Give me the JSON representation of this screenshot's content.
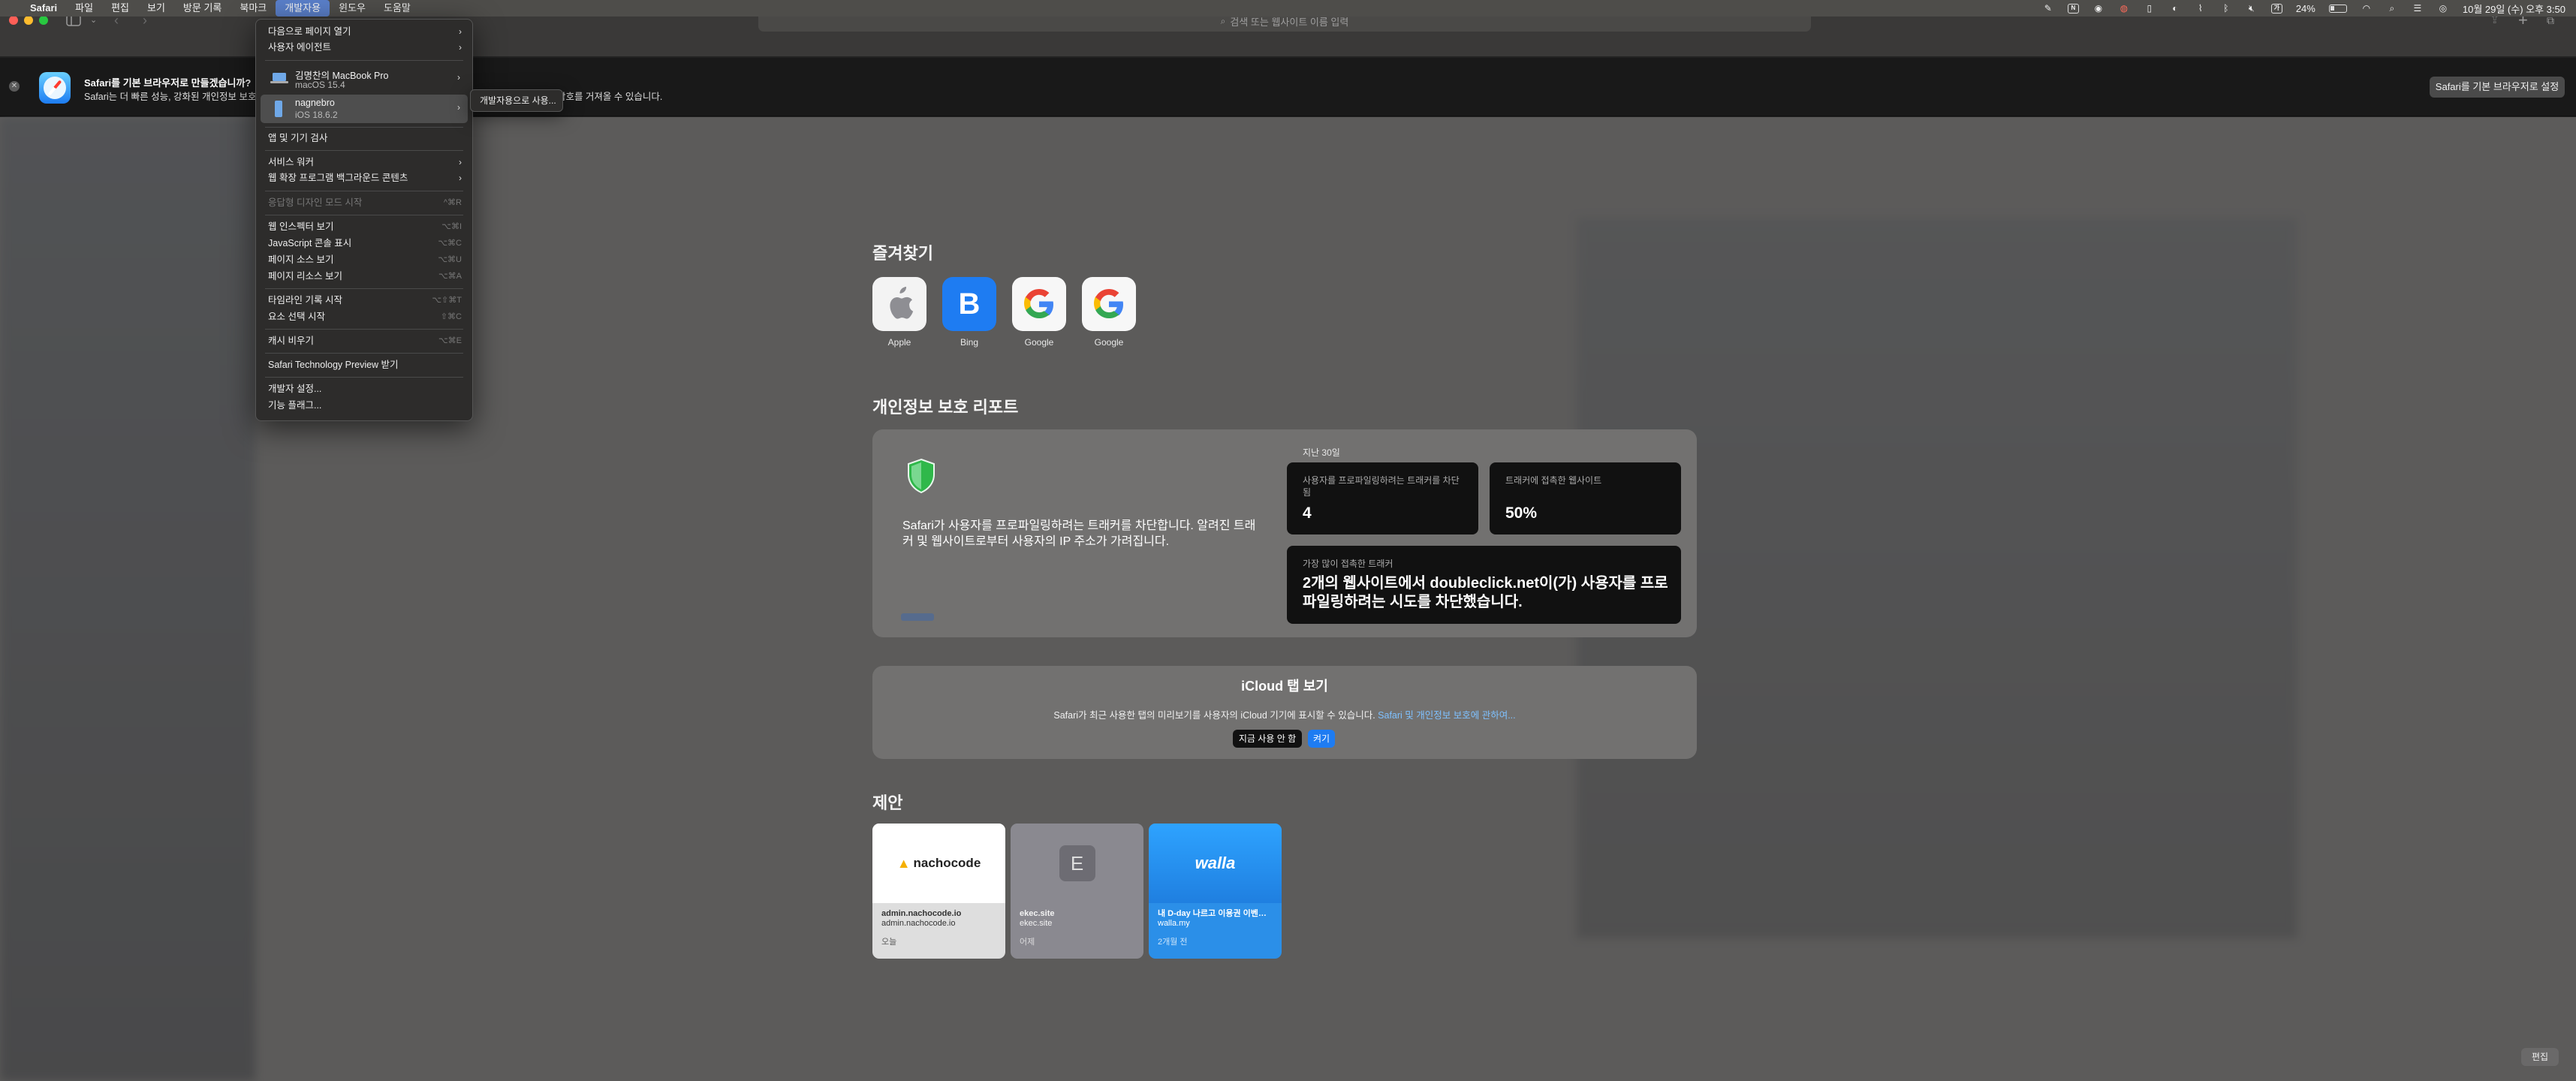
{
  "menubar": {
    "app": "Safari",
    "items": [
      "파일",
      "편집",
      "보기",
      "방문 기록",
      "북마크",
      "개발자용",
      "윈도우",
      "도움말"
    ],
    "battery": "24%",
    "datetime": "10월 29일 (수) 오후 3:50"
  },
  "toolbar": {
    "address_placeholder": "검색 또는 웹사이트 이름 입력"
  },
  "banner": {
    "title": "Safari를 기본 브라우저로 만들겠습니까?",
    "desc_start": "Safari는 더 빠른 성능, 강화된 개인정보 보호",
    "desc_end": "호 및 암호를 거져올 수 있습니다.",
    "button": "Safari를 기본 브라우저로 설정"
  },
  "develop_menu": {
    "open_page_with": "다음으로 페이지 열기",
    "user_agent": "사용자 에이전트",
    "devices": [
      {
        "name": "김명찬의 MacBook Pro",
        "os": "macOS 15.4"
      },
      {
        "name": "nagnebro",
        "os": "iOS 18.6.2"
      }
    ],
    "app_inspect": "앱 및 기기 검사",
    "service_workers": "서비스 워커",
    "web_ext_bg": "웹 확장 프로그램 백그라운드 콘텐츠",
    "responsive": {
      "label": "응답형 디자인 모드 시작",
      "shortcut": "^⌘R"
    },
    "web_inspector": {
      "label": "웹 인스펙터 보기",
      "shortcut": "⌥⌘I"
    },
    "js_console": {
      "label": "JavaScript 콘솔 표시",
      "shortcut": "⌥⌘C"
    },
    "page_source": {
      "label": "페이지 소스 보기",
      "shortcut": "⌥⌘U"
    },
    "page_resources": {
      "label": "페이지 리소스 보기",
      "shortcut": "⌥⌘A"
    },
    "timeline": {
      "label": "타임라인 기록 시작",
      "shortcut": "⌥⇧⌘T"
    },
    "element_select": {
      "label": "요소 선택 시작",
      "shortcut": "⇧⌘C"
    },
    "empty_cache": {
      "label": "캐시 비우기",
      "shortcut": "⌥⌘E"
    },
    "tech_preview": "Safari Technology Preview 받기",
    "dev_settings": "개발자 설정...",
    "feature_flags": "기능 플래그..."
  },
  "submenu": {
    "label": "개발자용으로 사용..."
  },
  "favorites": {
    "title": "즐겨찾기",
    "items": [
      {
        "label": "Apple",
        "glyph": ""
      },
      {
        "label": "Bing",
        "glyph": "B"
      },
      {
        "label": "Google",
        "glyph": "G"
      },
      {
        "label": "Google",
        "glyph": "G"
      }
    ]
  },
  "privacy": {
    "title": "개인정보 보호 리포트",
    "desc": "Safari가 사용자를 프로파일링하려는 트래커를 차단합니다. 알려진 트래커 및 웹사이트로부터 사용자의 IP 주소가 가려집니다.",
    "period": "지난 30일",
    "trackers_caption": "사용자를 프로파일링하려는 트래커를 차단됨",
    "trackers_value": "4",
    "sites_caption": "트래커에 접촉한 웹사이트",
    "sites_value": "50%",
    "top_caption": "가장 많이 접촉한 트래커",
    "top_text": "2개의 웹사이트에서 doubleclick.net이(가) 사용자를 프로파일링하려는 시도를 차단했습니다."
  },
  "icloud": {
    "title": "iCloud 탭 보기",
    "desc": "Safari가 최근 사용한 탭의 미리보기를 사용자의 iCloud 기기에 표시할 수 있습니다.",
    "link": "Safari 및 개인정보 보호에 관하여...",
    "not_now": "지금 사용 안 함",
    "enable": "켜기"
  },
  "suggestions": {
    "title": "제안",
    "items": [
      {
        "logo": "nachocode",
        "title": "admin.nachocode.io",
        "url": "admin.nachocode.io",
        "when": "오늘"
      },
      {
        "logo": "E",
        "title": "ekec.site",
        "url": "ekec.site",
        "when": "어제"
      },
      {
        "logo": "walla",
        "title": "내 D-day 나르고 이용권 이벤트...",
        "url": "walla.my",
        "when": "2개월 전"
      }
    ]
  },
  "edit_label": "편집",
  "colors": {
    "accent": "#1e7cf2",
    "shield": "#2fb84a",
    "menu_highlight": "#5a7fc9"
  }
}
